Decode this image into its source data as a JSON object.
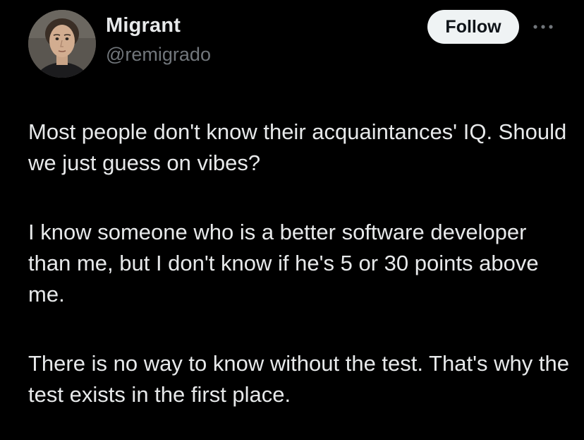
{
  "author": {
    "display_name": "Migrant",
    "handle": "@remigrado",
    "avatar_icon": "user-avatar"
  },
  "actions": {
    "follow_label": "Follow",
    "more_icon": "more-horizontal-icon"
  },
  "tweet": {
    "paragraphs": [
      "Most people don't know their acquaintances' IQ. Should we just guess on vibes?",
      "I know someone who is a better software developer than me, but I don't know if he's 5 or 30 points above me.",
      "There is no way to know without the test. That's why the test exists in the first place."
    ]
  },
  "colors": {
    "background": "#000000",
    "primary_text": "#e7e9ea",
    "secondary_text": "#71767b",
    "follow_bg": "#eff3f4",
    "follow_text": "#0f1419"
  }
}
